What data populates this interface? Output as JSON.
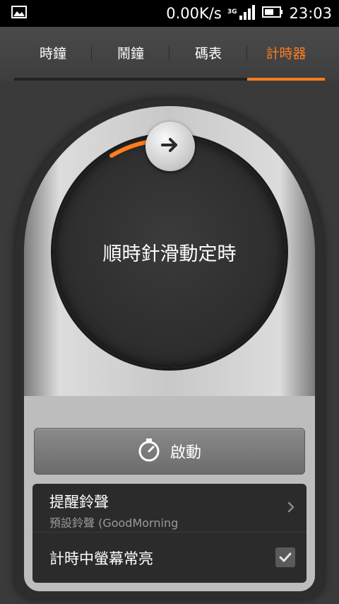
{
  "status": {
    "speed": "0.00K/s",
    "network": "3G",
    "time": "23:03",
    "icons": [
      "image-notification-icon",
      "signal-icon",
      "battery-icon"
    ]
  },
  "tabs": [
    {
      "label": "時鐘",
      "active": false
    },
    {
      "label": "鬧鐘",
      "active": false
    },
    {
      "label": "碼表",
      "active": false
    },
    {
      "label": "計時器",
      "active": true
    }
  ],
  "colors": {
    "accent": "#ff7d1d",
    "background": "#3a3a3a",
    "dial": "#2c2c2c"
  },
  "dial": {
    "instruction": "順時針滑動定時",
    "knob_icon": "arrow-right-icon"
  },
  "start_button": {
    "label": "啟動",
    "icon": "stopwatch-icon"
  },
  "settings": {
    "ringtone_title": "提醒鈴聲",
    "ringtone_value": "預設鈴聲 (GoodMorning",
    "screen_on_title": "計時中螢幕常亮",
    "screen_on_checked": true
  }
}
